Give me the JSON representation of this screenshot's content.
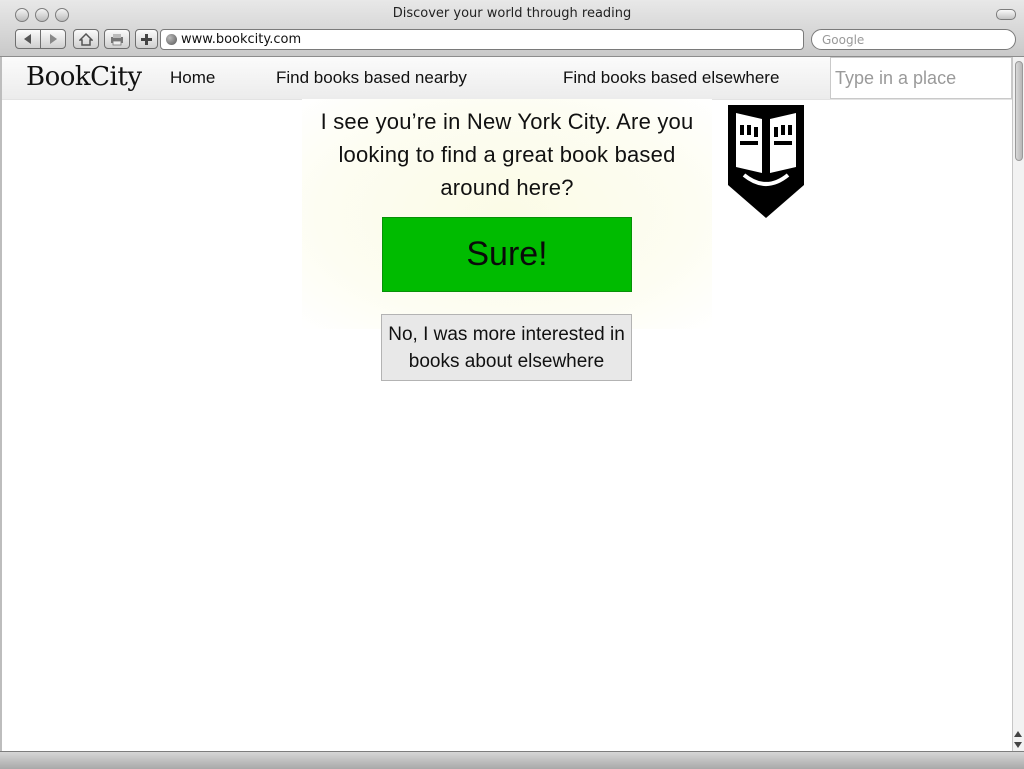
{
  "window": {
    "title": "Discover your world through reading",
    "url": "www.bookcity.com",
    "search_placeholder": "Google"
  },
  "toolbar": {
    "back_icon": "back-arrow-icon",
    "forward_icon": "forward-arrow-icon",
    "home_icon": "home-icon",
    "print_icon": "print-icon",
    "add_icon": "plus-icon"
  },
  "nav": {
    "brand": "BookCity",
    "links": [
      "Home",
      "Find books based nearby",
      "Find books based elsewhere"
    ],
    "place_placeholder": "Type in a place"
  },
  "main": {
    "question": "I see you’re in New York City.  Are you looking to find a great book based around here?",
    "sure_label": "Sure!",
    "no_label": "No, I was more interested in books about elsewhere",
    "logo_icon": "open-book-shield-icon"
  },
  "colors": {
    "sure_button": "#00bb00",
    "no_button": "#e8e8e8",
    "card_background": "#fbfbe6"
  }
}
